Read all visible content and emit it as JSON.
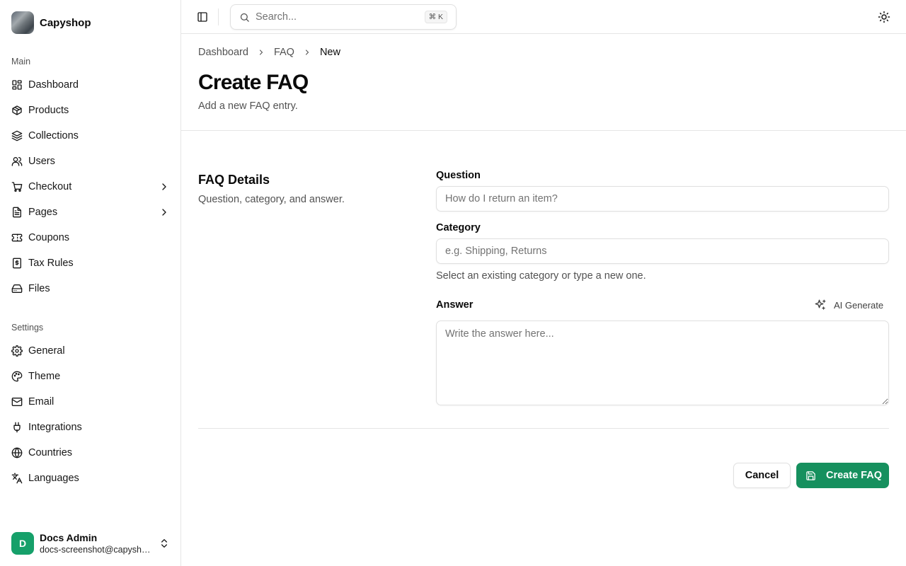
{
  "brand": {
    "name": "Capyshop"
  },
  "sidebar": {
    "main_label": "Main",
    "main_items": [
      {
        "label": "Dashboard",
        "icon": "layout-dashboard-icon"
      },
      {
        "label": "Products",
        "icon": "package-icon"
      },
      {
        "label": "Collections",
        "icon": "layers-icon"
      },
      {
        "label": "Users",
        "icon": "users-icon"
      },
      {
        "label": "Checkout",
        "icon": "shopping-cart-icon",
        "has_children": true
      },
      {
        "label": "Pages",
        "icon": "file-text-icon",
        "has_children": true
      },
      {
        "label": "Coupons",
        "icon": "ticket-icon"
      },
      {
        "label": "Tax Rules",
        "icon": "receipt-icon"
      },
      {
        "label": "Files",
        "icon": "hard-drive-icon"
      }
    ],
    "settings_label": "Settings",
    "settings_items": [
      {
        "label": "General",
        "icon": "gear-icon"
      },
      {
        "label": "Theme",
        "icon": "palette-icon"
      },
      {
        "label": "Email",
        "icon": "mail-icon"
      },
      {
        "label": "Integrations",
        "icon": "plug-icon"
      },
      {
        "label": "Countries",
        "icon": "globe-icon"
      },
      {
        "label": "Languages",
        "icon": "languages-icon"
      }
    ]
  },
  "user": {
    "initial": "D",
    "name": "Docs Admin",
    "email": "docs-screenshot@capyshop.com"
  },
  "topbar": {
    "search_placeholder": "Search...",
    "shortcut": "⌘ K"
  },
  "breadcrumb": {
    "items": [
      "Dashboard",
      "FAQ"
    ],
    "current": "New"
  },
  "page": {
    "title": "Create FAQ",
    "subtitle": "Add a new FAQ entry."
  },
  "section": {
    "title": "FAQ Details",
    "subtitle": "Question, category, and answer."
  },
  "form": {
    "question_label": "Question",
    "question_placeholder": "How do I return an item?",
    "category_label": "Category",
    "category_placeholder": "e.g. Shipping, Returns",
    "category_hint": "Select an existing category or type a new one.",
    "answer_label": "Answer",
    "ai_generate_label": "AI Generate",
    "answer_placeholder": "Write the answer here..."
  },
  "actions": {
    "cancel_label": "Cancel",
    "create_label": "Create FAQ"
  },
  "colors": {
    "primary": "#16905e",
    "avatar": "#16a06a"
  }
}
